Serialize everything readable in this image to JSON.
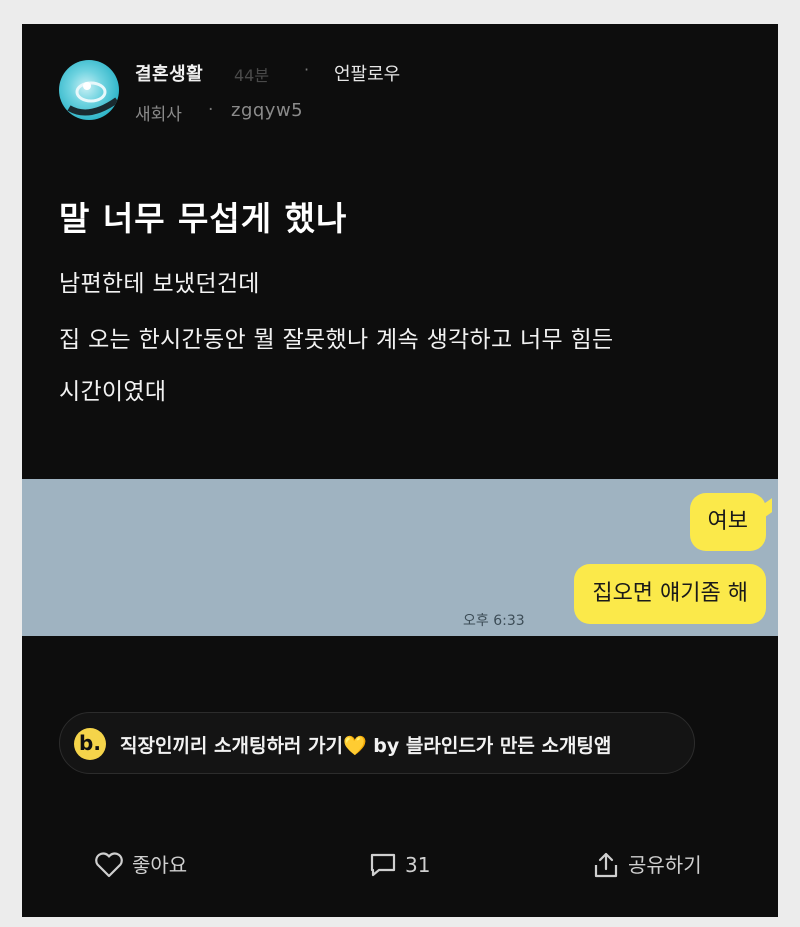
{
  "post": {
    "channel": "결혼생활",
    "time": "44분",
    "separator": "·",
    "unfollow_label": "언팔로우",
    "company": "새회사",
    "user_id": "zgqyw5",
    "title": "말 너무 무섭게 했나",
    "body_lines": [
      "남편한테 보냈던건데",
      "집 오는 한시간동안 뭘 잘못했나 계속 생각하고 너무 힘든",
      "시간이였대"
    ]
  },
  "chat": {
    "messages": [
      "여보",
      "집오면 얘기좀 해"
    ],
    "timestamp": "오후 6:33",
    "bubble_color": "#fbe94a",
    "background_color": "#9fb3c1"
  },
  "ad": {
    "logo_letter": "b.",
    "text": "직장인끼리 소개팅하러 가기",
    "heart": "💛",
    "text_tail": " by 블라인드가 만든 소개팅앱"
  },
  "actions": {
    "like_label": "좋아요",
    "like_icon": "heart-outline-icon",
    "comment_count": "31",
    "comment_icon": "speech-bubble-icon",
    "share_label": "공유하기",
    "share_icon": "share-upload-icon"
  }
}
